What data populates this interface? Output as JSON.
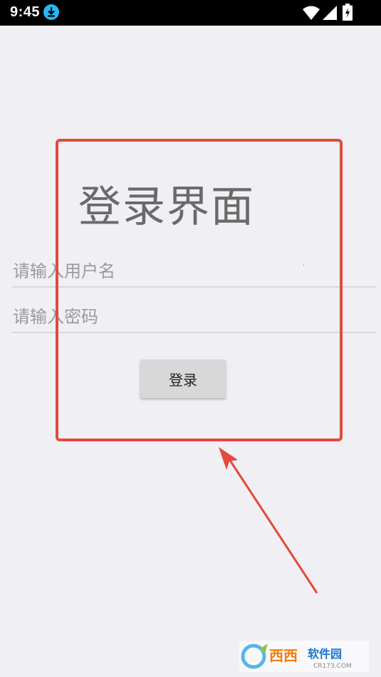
{
  "status_bar": {
    "time": "9:45",
    "icons": [
      "download-icon",
      "wifi-icon",
      "signal-icon",
      "battery-icon"
    ]
  },
  "login": {
    "title": "登录界面",
    "username_placeholder": "请输入用户名",
    "password_placeholder": "请输入密码",
    "button_label": "登录"
  },
  "annotation": {
    "color": "#e24a3a"
  },
  "watermark": {
    "brand": "西西软件园",
    "url": "CR173.COM"
  },
  "colors": {
    "background": "#f0eff4",
    "status_bar": "#000000",
    "download_badge": "#29b6f6",
    "title_text": "#6a6a6a",
    "button_bg": "#d8d8d8"
  }
}
